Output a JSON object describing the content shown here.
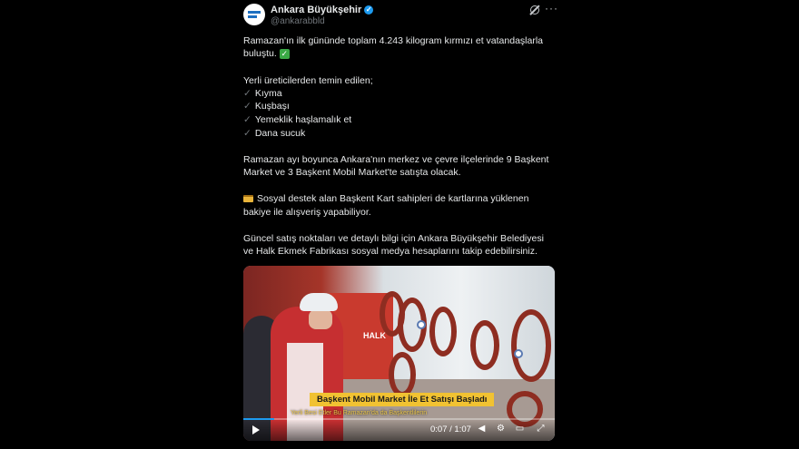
{
  "author": {
    "name": "Ankara Büyükşehir",
    "handle": "@ankarabbld"
  },
  "icons": {
    "verified": "verified-badge-icon",
    "grok": "grok-icon",
    "more": "more-icon"
  },
  "tweet": {
    "lines": [
      "Ramazan'ın ilk gününde toplam 4.243 kilogram kırmızı et vatandaşlarla",
      "buluştu.",
      "Yerli üreticilerden temin edilen;",
      "Kıyma",
      "Kuşbaşı",
      "Yemeklik haşlamalık et",
      "Dana sucuk",
      "Ramazan ayı boyunca Ankara'nın merkez ve çevre ilçelerinde 9 Başkent",
      "Market ve 3 Başkent Mobil Market'te satışta olacak.",
      "Sosyal destek alan Başkent Kart sahipleri de kartlarına yüklenen",
      "bakiye ile alışveriş yapabiliyor.",
      "Güncel satış noktaları ve detaylı bilgi için Ankara Büyükşehir Belediyesi",
      "ve Halk Ekmek Fabrikası sosyal medya hesaplarını takip edebilirsiniz."
    ]
  },
  "video": {
    "banner": "HALK",
    "caption_title": "Başkent Mobil Market İle Et Satışı Başladı",
    "caption_sub": "Yerli Besi Etler Bu Ramazan'da da Başkentlilerin",
    "time": "0:07 / 1:07",
    "progress": 0.1
  }
}
